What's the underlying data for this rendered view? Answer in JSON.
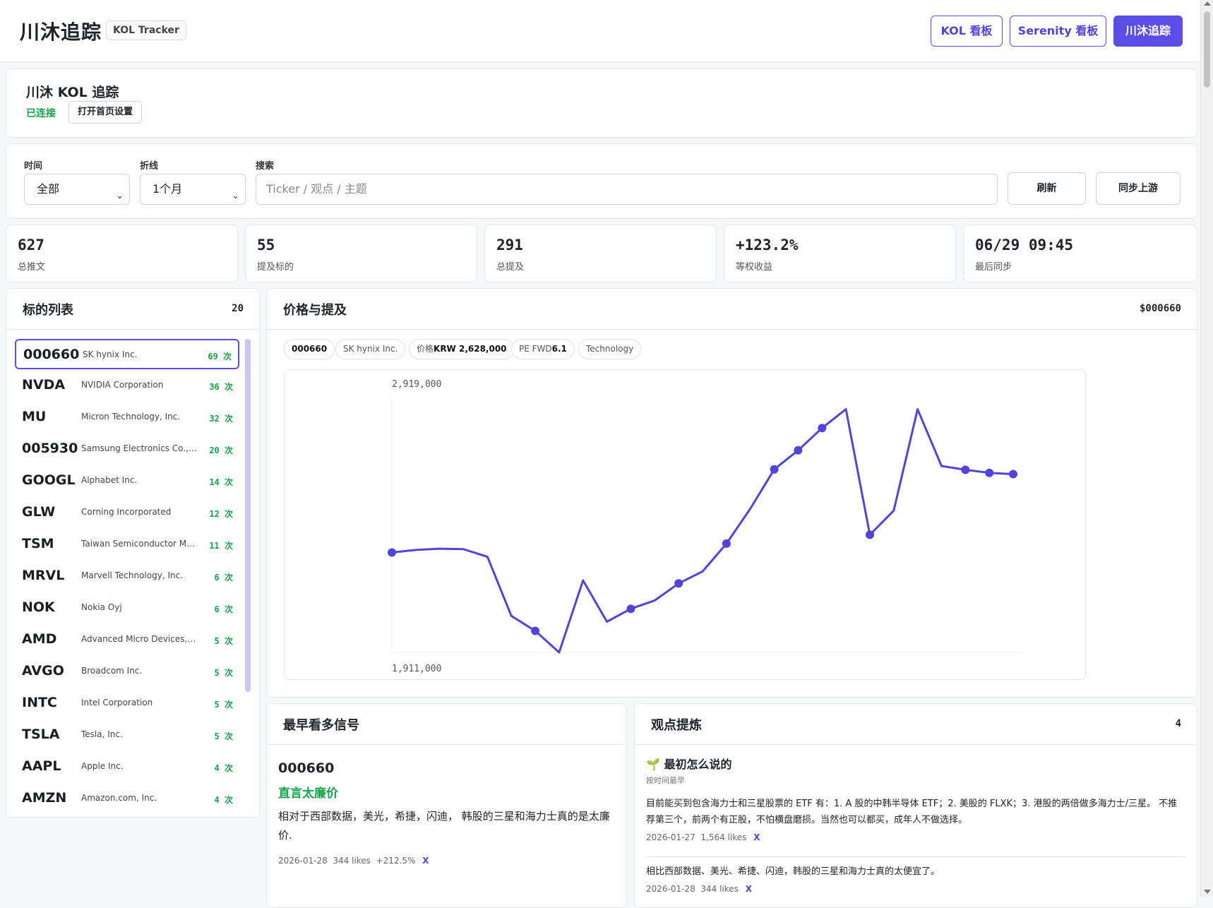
{
  "header": {
    "brand": "川沐追踪",
    "tag": "KOL Tracker",
    "nav": [
      {
        "label": "KOL 看板"
      },
      {
        "label": "Serenity 看板"
      },
      {
        "label": "川沐追踪"
      }
    ]
  },
  "kol": {
    "title": "川沐 KOL 追踪",
    "status": "已连接",
    "settings_label": "打开首页设置"
  },
  "filters": {
    "time_label": "时间",
    "time_value": "全部",
    "line_label": "折线",
    "line_value": "1个月",
    "search_label": "搜索",
    "search_placeholder": "Ticker / 观点 / 主题",
    "refresh_label": "刷新",
    "sync_label": "同步上游"
  },
  "stats": [
    {
      "value": "627",
      "label": "总推文"
    },
    {
      "value": "55",
      "label": "提及标的"
    },
    {
      "value": "291",
      "label": "总提及"
    },
    {
      "value": "+123.2%",
      "label": "等权收益"
    },
    {
      "value": "06/29 09:45",
      "label": "最后同步"
    }
  ],
  "ticker_list": {
    "title": "标的列表",
    "count": "20",
    "items": [
      {
        "symbol": "000660",
        "name": "SK hynix Inc.",
        "count": "69 次"
      },
      {
        "symbol": "NVDA",
        "name": "NVIDIA Corporation",
        "count": "36 次"
      },
      {
        "symbol": "MU",
        "name": "Micron Technology, Inc.",
        "count": "32 次"
      },
      {
        "symbol": "005930",
        "name": "Samsung Electronics Co., Ltd.",
        "count": "20 次"
      },
      {
        "symbol": "GOOGL",
        "name": "Alphabet Inc.",
        "count": "14 次"
      },
      {
        "symbol": "GLW",
        "name": "Corning Incorporated",
        "count": "12 次"
      },
      {
        "symbol": "TSM",
        "name": "Taiwan Semiconductor Manufacturing",
        "count": "11 次"
      },
      {
        "symbol": "MRVL",
        "name": "Marvell Technology, Inc.",
        "count": "6 次"
      },
      {
        "symbol": "NOK",
        "name": "Nokia Oyj",
        "count": "6 次"
      },
      {
        "symbol": "AMD",
        "name": "Advanced Micro Devices, Inc.",
        "count": "5 次"
      },
      {
        "symbol": "AVGO",
        "name": "Broadcom Inc.",
        "count": "5 次"
      },
      {
        "symbol": "INTC",
        "name": "Intel Corporation",
        "count": "5 次"
      },
      {
        "symbol": "TSLA",
        "name": "Tesla, Inc.",
        "count": "5 次"
      },
      {
        "symbol": "AAPL",
        "name": "Apple Inc.",
        "count": "4 次"
      },
      {
        "symbol": "AMZN",
        "name": "Amazon.com, Inc.",
        "count": "4 次"
      }
    ]
  },
  "price_panel": {
    "title": "价格与提及",
    "symbol": "$000660",
    "chips": {
      "ticker": "000660",
      "company": "SK hynix Inc.",
      "price_label": "价格",
      "price_value": "KRW 2,628,000",
      "pe_label": "PE FWD",
      "pe_value": "6.1",
      "sector": "Technology"
    }
  },
  "chart_data": {
    "type": "line",
    "title": "",
    "ylim": [
      1911000,
      2919000
    ],
    "y_tick_labels": [
      "2,919,000",
      "1,911,000"
    ],
    "x": [
      0,
      1,
      2,
      3,
      4,
      5,
      6,
      7,
      8,
      9,
      10,
      11,
      12,
      13,
      14,
      15,
      16,
      17,
      18,
      19,
      20,
      21,
      22,
      23,
      24,
      25,
      26
    ],
    "values": [
      2305000,
      2315000,
      2320000,
      2318000,
      2288000,
      2055000,
      1996000,
      1911000,
      2195000,
      2032000,
      2083000,
      2116000,
      2183000,
      2230000,
      2340000,
      2478000,
      2633000,
      2708000,
      2796000,
      2870000,
      2375000,
      2470000,
      2870000,
      2646000,
      2631000,
      2619000,
      2614000
    ],
    "mention_points": [
      0,
      6,
      10,
      12,
      14,
      16,
      17,
      18,
      20,
      24,
      25,
      27
    ],
    "color": "#5145d9",
    "grid": false
  },
  "signals": {
    "title": "最早看多信号",
    "ticker": "000660",
    "headline": "直言太廉价",
    "body": "相对于西部数据，美光，希捷，闪迪， 韩股的三星和海力士真的是太廉价.",
    "date": "2026-01-28",
    "likes": "344 likes",
    "return": "+212.5%",
    "source": "X"
  },
  "insights": {
    "title": "观点提炼",
    "count": "4",
    "section_icon": "🌱",
    "section_title": "最初怎么说的",
    "section_sub": "按时间最早",
    "items": [
      {
        "text": "目前能买到包含海力士和三星股票的 ETF 有：1. A 股的中韩半导体 ETF；2. 美股的 FLXK；3. 港股的两倍做多海力士/三星。 不推荐第三个，前两个有正股，不怕横盘磨损。当然也可以都买，成年人不做选择。",
        "date": "2026-01-27",
        "likes": "1,564 likes",
        "source": "X"
      },
      {
        "text": "相比西部数据、美光、希捷、闪迪，韩股的三星和海力士真的太便宜了。",
        "date": "2026-01-28",
        "likes": "344 likes",
        "source": "X"
      }
    ]
  }
}
